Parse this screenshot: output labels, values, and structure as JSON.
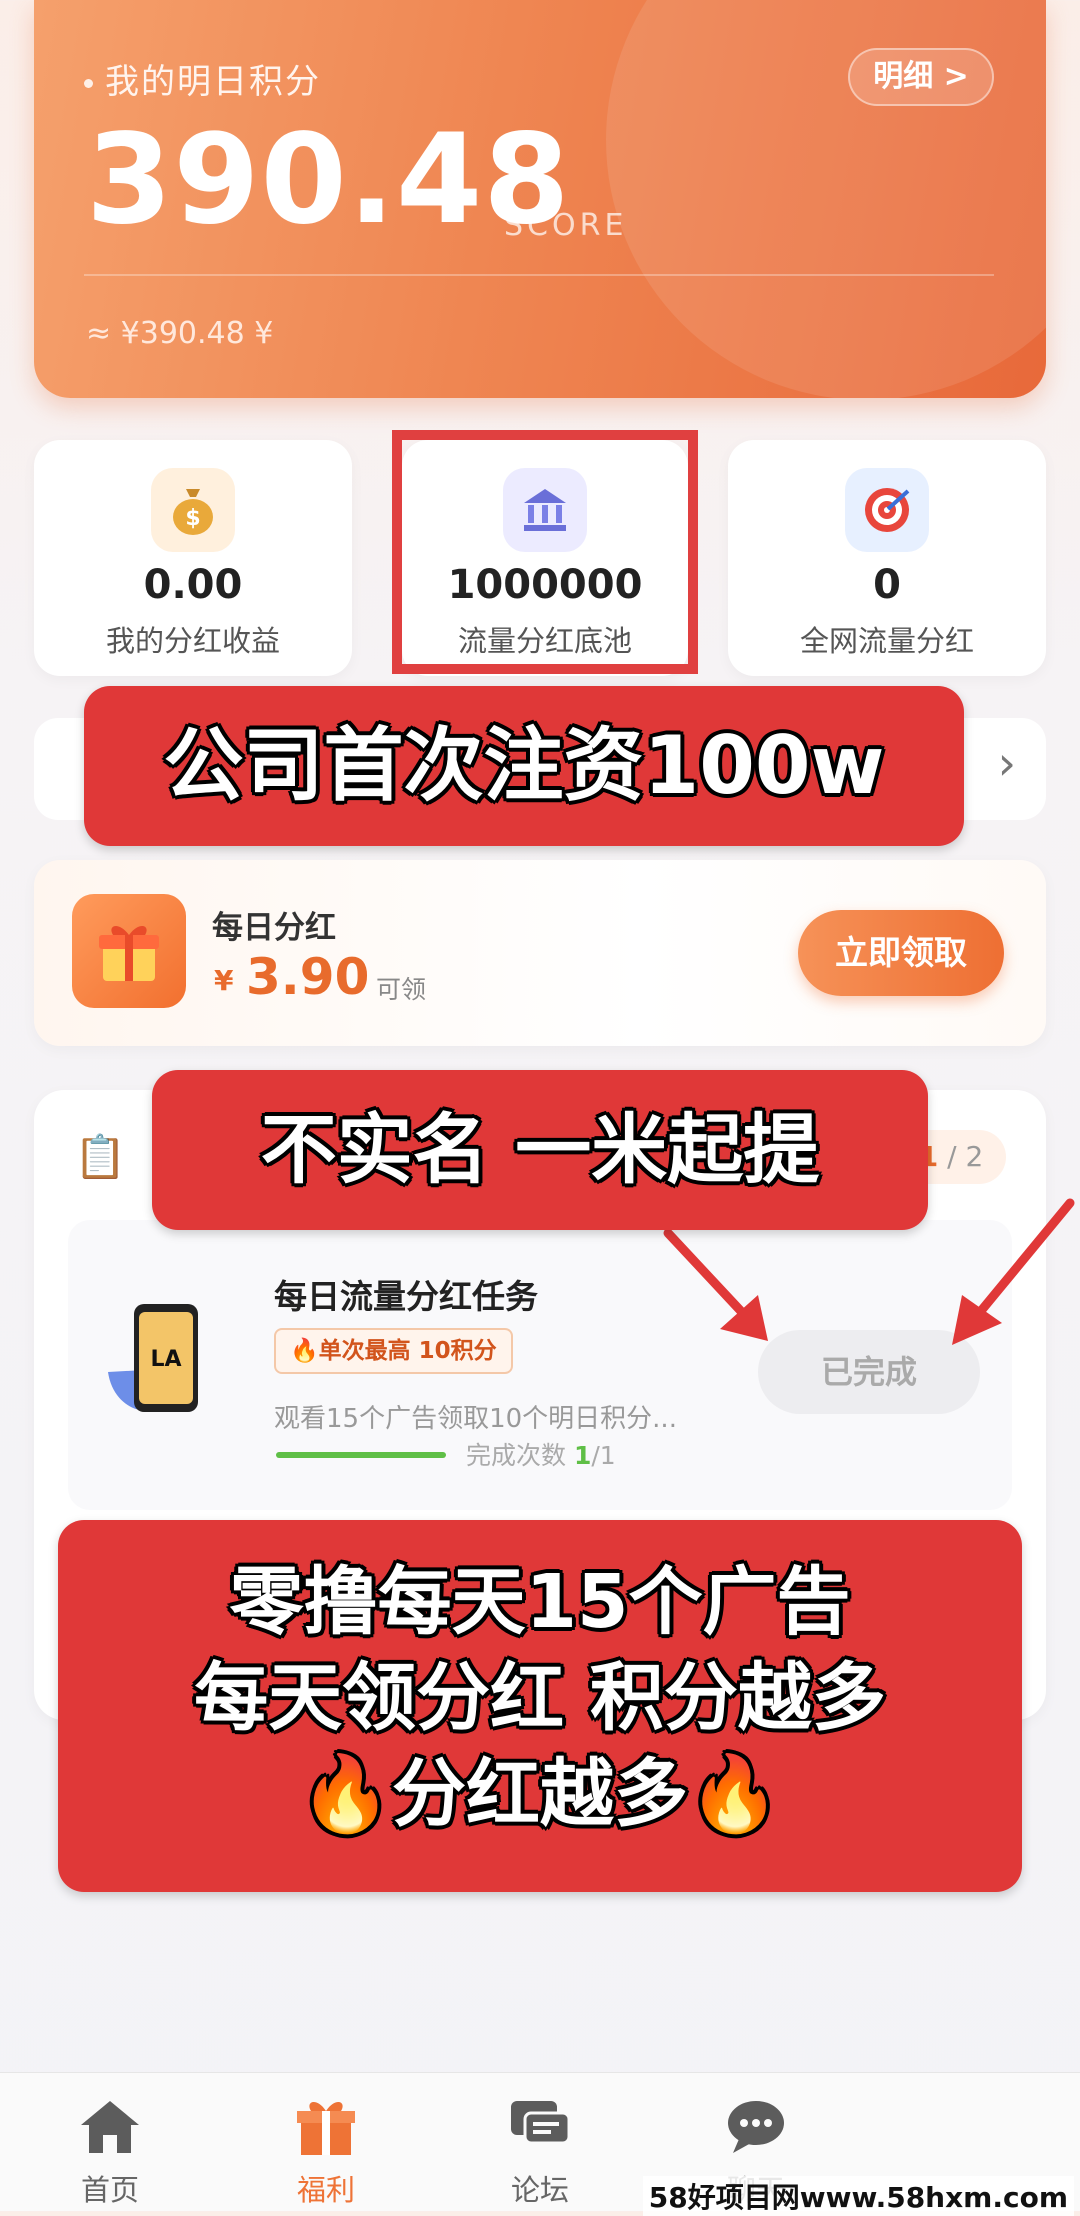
{
  "score_card": {
    "title": "我的明日积分",
    "detail_button": "明细 >",
    "value": "390.48",
    "unit": "SCORE",
    "rmb_equivalent": "≈ ¥390.48 ¥"
  },
  "stats": [
    {
      "icon": "money-bag-icon",
      "value": "0.00",
      "label": "我的分红收益"
    },
    {
      "icon": "bank-icon",
      "value": "1000000",
      "label": "流量分红底池"
    },
    {
      "icon": "target-icon",
      "value": "0",
      "label": "全网流量分红"
    }
  ],
  "dividend": {
    "title": "每日分红",
    "currency": "¥",
    "amount": "3.90",
    "suffix": "可领",
    "button": "立即领取"
  },
  "task_section": {
    "pager_current": "1",
    "pager_total": "/ 2",
    "task": {
      "title": "每日流量分红任务",
      "badge": "🔥单次最高 10积分",
      "description": "观看15个广告领取10个明日积分...",
      "count_label": "完成次数",
      "count_done": "1",
      "count_total": "/1",
      "status_button": "已完成",
      "app_logo_text": "LA"
    }
  },
  "overlays": {
    "invest": "公司首次注资100w",
    "realname": "不实名 一米起提",
    "ads_line1": "零撸每天15个广告",
    "ads_line2": "每天领分红 积分越多",
    "ads_line3": "🔥分红越多🔥"
  },
  "nav": [
    {
      "icon": "home-icon",
      "label": "首页",
      "active": false
    },
    {
      "icon": "gift-icon",
      "label": "福利",
      "active": true
    },
    {
      "icon": "forum-icon",
      "label": "论坛",
      "active": false
    },
    {
      "icon": "chat-icon",
      "label": "聊天",
      "active": false
    }
  ],
  "watermark": "58好项目网www.58hxm.com",
  "colors": {
    "accent": "#ee7336",
    "highlight_red": "#e03838",
    "success_green": "#5fbf46"
  }
}
